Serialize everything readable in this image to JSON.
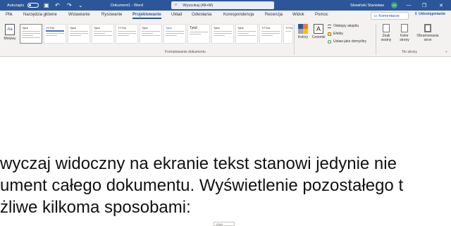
{
  "titlebar": {
    "autosave_label": "Autozapis",
    "doc_title": "Dokument1 - Word",
    "search_placeholder": "Wyszukaj (Alt+M)",
    "user_name": "Słowiński Stanisław",
    "user_initials": "SS",
    "bg_color": "#2b579a",
    "icons": [
      "save-icon",
      "undo-icon",
      "redo-icon",
      "dropdown-icon",
      "search-icon",
      "minimize-icon",
      "restore-icon",
      "close-icon"
    ]
  },
  "tabs": [
    {
      "label": "Plik"
    },
    {
      "label": "Narzędzia główne"
    },
    {
      "label": "Wstawianie"
    },
    {
      "label": "Rysowanie"
    },
    {
      "label": "Projektowanie",
      "active": true
    },
    {
      "label": "Układ"
    },
    {
      "label": "Odwołania"
    },
    {
      "label": "Korespondencja"
    },
    {
      "label": "Recenzja"
    },
    {
      "label": "Widok"
    },
    {
      "label": "Pomoc"
    }
  ],
  "tab_actions": {
    "comments_label": "Komentarze",
    "share_label": "Udostępnianie"
  },
  "ribbon": {
    "themes_label": "Motywy",
    "style_gallery": [
      {
        "title": "Tytuł"
      },
      {
        "title": "TYTUŁ"
      },
      {
        "title": "Tytuł"
      },
      {
        "title": "Tytuł"
      },
      {
        "title": "TYTUŁ"
      },
      {
        "title": "Tytuł"
      },
      {
        "title": "Tytuł"
      },
      {
        "title": "Tytuł"
      },
      {
        "title": "Tytuł"
      },
      {
        "title": "Tytuł"
      },
      {
        "title": "TYTUŁ"
      },
      {
        "title": "TYTUŁ"
      }
    ],
    "format_group_label": "Formatowanie dokumentu",
    "colors_label": "Kolory",
    "fonts_label": "Czcionki",
    "paragraph_spacing_label": "Odstępy akapitu",
    "effects_label": "Efekty",
    "set_default_label": "Ustaw jako domyślny",
    "watermark_label": "Znak wodny",
    "page_color_label": "Kolor strony",
    "page_borders_label": "Obramowania stron",
    "page_bg_group_label": "Tło strony"
  },
  "document": {
    "lines": [
      "wyczaj widoczny na ekranie tekst stanowi jedynie nie",
      "ument całego dokumentu. Wyświetlenie pozostałego t",
      "żliwe kilkoma sposobami:"
    ],
    "paste_options_label": "(Ctrl)"
  }
}
